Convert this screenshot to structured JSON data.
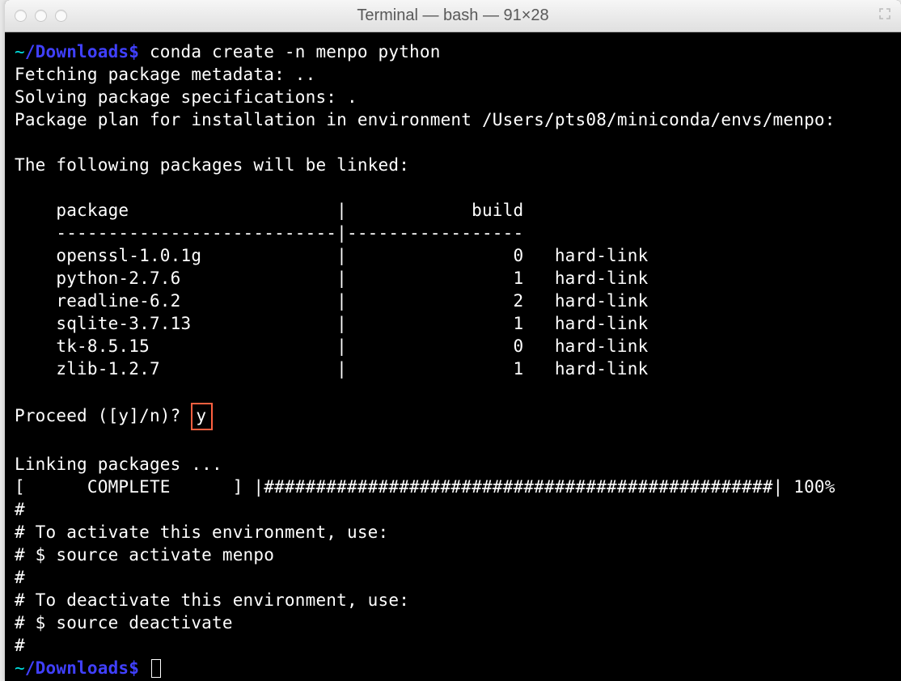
{
  "window": {
    "title": "Terminal — bash — 91×28"
  },
  "prompt": {
    "tilde": "~",
    "path": "/Downloads",
    "dollar": "$"
  },
  "cmd1": "conda create -n menpo python",
  "out": {
    "l1": "Fetching package metadata: ..",
    "l2": "Solving package specifications: .",
    "l3": "Package plan for installation in environment /Users/pts08/miniconda/envs/menpo:",
    "l4": "The following packages will be linked:",
    "header": "    package                    |            build",
    "divider": "    ---------------------------|-----------------",
    "rows": [
      "    openssl-1.0.1g             |                0   hard-link",
      "    python-2.7.6               |                1   hard-link",
      "    readline-6.2               |                2   hard-link",
      "    sqlite-3.7.13              |                1   hard-link",
      "    tk-8.5.15                  |                0   hard-link",
      "    zlib-1.2.7                 |                1   hard-link"
    ],
    "proceed_q": "Proceed ([y]/n)?",
    "proceed_ans": "y",
    "linking": "Linking packages ...",
    "progress": "[      COMPLETE      ] |#################################################| 100%",
    "c1": "#",
    "c2": "# To activate this environment, use:",
    "c3": "# $ source activate menpo",
    "c4": "#",
    "c5": "# To deactivate this environment, use:",
    "c6": "# $ source deactivate",
    "c7": "#"
  }
}
